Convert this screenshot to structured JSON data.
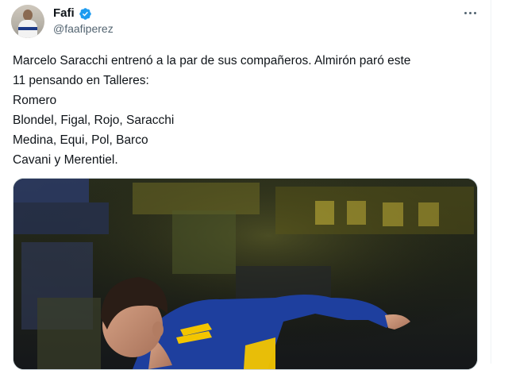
{
  "tweet": {
    "author": {
      "display_name": "Fafi",
      "handle": "@faafiperez",
      "verified": true
    },
    "more_icon": "more-horizontal-icon",
    "text_lines": [
      "Marcelo Saracchi entrenó a la par de sus compañeros. Almirón paró este",
      "11 pensando en Talleres:",
      "Romero",
      "Blondel, Figal, Rojo, Saracchi",
      "Medina, Equi, Pol, Barco",
      "Cavani y Merentiel."
    ]
  },
  "colors": {
    "verified_badge": "#1d9bf0",
    "secondary_text": "#536471",
    "primary_text": "#0f1419",
    "jersey_blue": "#1e3f9e",
    "jersey_yellow": "#f3c500"
  }
}
